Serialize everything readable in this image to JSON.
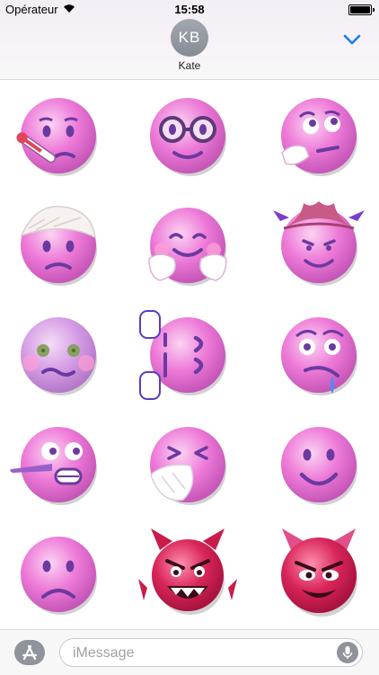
{
  "status_bar": {
    "carrier": "Opérateur",
    "time": "15:58"
  },
  "conversation": {
    "contact_initials": "KB",
    "contact_name": "Kate"
  },
  "colors": {
    "accent": "#1a7cf0",
    "sticker_pink": "#ee7ad8",
    "sticker_devil": "#d8255a"
  },
  "stickers": [
    {
      "icon": "sick-thermometer-face-icon"
    },
    {
      "icon": "nerd-glasses-face-icon"
    },
    {
      "icon": "thinking-face-icon"
    },
    {
      "icon": "bandaged-head-face-icon"
    },
    {
      "icon": "hugging-face-icon"
    },
    {
      "icon": "cowboy-devil-face-icon"
    },
    {
      "icon": "nauseated-face-icon"
    },
    {
      "icon": "upside-down-sideways-face-icon"
    },
    {
      "icon": "drooling-face-icon"
    },
    {
      "icon": "lying-long-nose-face-icon"
    },
    {
      "icon": "sneezing-tissue-face-icon"
    },
    {
      "icon": "smiling-face-icon"
    },
    {
      "icon": "frowning-face-icon"
    },
    {
      "icon": "angry-devil-face-icon"
    },
    {
      "icon": "smiling-devil-face-icon"
    }
  ],
  "input": {
    "placeholder": "iMessage"
  }
}
